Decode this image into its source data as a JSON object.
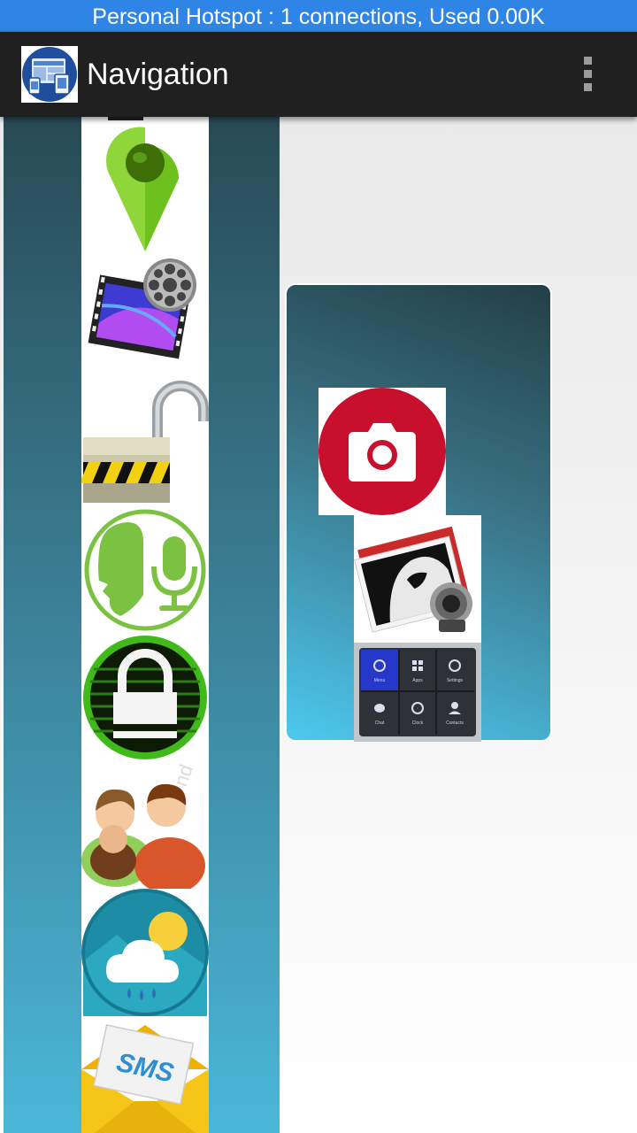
{
  "status_bar": {
    "text": "Personal Hotspot : 1 connections, Used 0.00K"
  },
  "app_bar": {
    "title": "Navigation",
    "logo_icon": "device-layout-icon",
    "menu_icon": "overflow-menu-icon"
  },
  "left_strip_icons": [
    "location-pin-icon",
    "video-film-icon",
    "unlocked-padlock-icon",
    "voice-recognition-icon",
    "secure-lock-icon",
    "people-chat-icon",
    "weather-icon",
    "sms-envelope-icon"
  ],
  "card_icons": [
    "camera-icon",
    "photo-viewer-icon",
    "app-grid-icon"
  ],
  "icon_labels": {
    "sms": "SMS",
    "grid_tiles": [
      "Menu",
      "Apps",
      "Settings",
      "Chat",
      "Clock",
      "Contacts"
    ]
  },
  "colors": {
    "status_bar": "#2f85e6",
    "app_bar": "#202020",
    "panel_top": "#284a54",
    "panel_bottom": "#4ab7d8",
    "camera_red": "#c8102e",
    "pin_green": "#6cc11d"
  }
}
